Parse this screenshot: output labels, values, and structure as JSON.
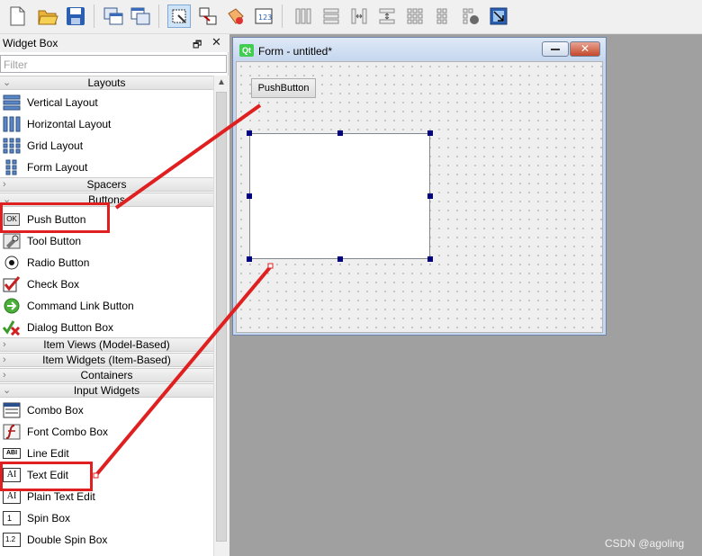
{
  "toolbar": {
    "buttons": [
      "new-file-icon",
      "open-folder-icon",
      "save-icon",
      "window-stack-icon",
      "window-stack-alt-icon",
      "edit-widgets-icon",
      "edit-signals-icon",
      "edit-buddies-icon",
      "edit-tab-order-icon",
      "horizontal-layout-icon",
      "vertical-layout-icon",
      "horizontal-splitter-icon",
      "vertical-splitter-icon",
      "grid-layout-icon",
      "form-layout-icon",
      "break-layout-icon",
      "adjust-size-icon"
    ]
  },
  "widget_box": {
    "title": "Widget Box",
    "float_icon": "🗗",
    "close_icon": "✕",
    "filter_placeholder": "Filter",
    "categories": {
      "layouts": "Layouts",
      "spacers": "Spacers",
      "buttons": "Buttons",
      "item_views": "Item Views (Model-Based)",
      "item_widgets": "Item Widgets (Item-Based)",
      "containers": "Containers",
      "input_widgets": "Input Widgets"
    },
    "layout_items": [
      "Vertical Layout",
      "Horizontal Layout",
      "Grid Layout",
      "Form Layout"
    ],
    "button_items": [
      "Push Button",
      "Tool Button",
      "Radio Button",
      "Check Box",
      "Command Link Button",
      "Dialog Button Box"
    ],
    "input_items": [
      "Combo Box",
      "Font Combo Box",
      "Line Edit",
      "Text Edit",
      "Plain Text Edit",
      "Spin Box",
      "Double Spin Box"
    ],
    "icon_text": {
      "push": "OK",
      "line": "ABI",
      "text": "AI",
      "plain": "AI",
      "spin": "1",
      "dspin": "1.2"
    }
  },
  "form": {
    "logo": "Qt",
    "title": "Form - untitled*",
    "close_glyph": "✕",
    "push_button_label": "PushButton"
  },
  "watermark": "CSDN @agoling",
  "colors": {
    "annotation_red": "#e02020",
    "selection_handle": "#000080",
    "canvas_gray": "#a0a0a0"
  }
}
